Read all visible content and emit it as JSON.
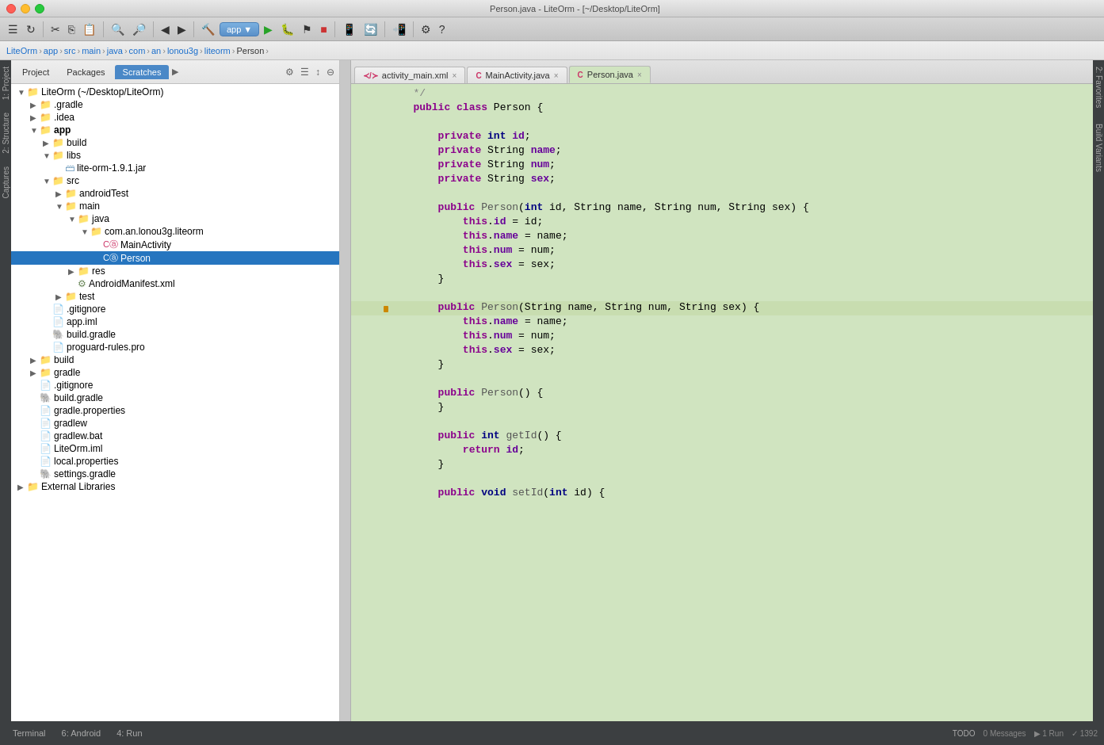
{
  "titleBar": {
    "title": "Person.java - LiteOrm - [~/Desktop/LiteOrm]"
  },
  "breadcrumb": {
    "items": [
      "LiteOrm",
      "app",
      "src",
      "main",
      "java",
      "com",
      "an",
      "lonou3g",
      "liteorm",
      "Person"
    ]
  },
  "projectPanel": {
    "tabs": [
      "Project",
      "Packages",
      "Scratches"
    ],
    "activeTab": "Project",
    "rootLabel": "LiteOrm (~/Desktop/LiteOrm)"
  },
  "editorTabs": [
    {
      "label": "activity_main.xml",
      "type": "xml",
      "active": false
    },
    {
      "label": "MainActivity.java",
      "type": "java",
      "active": false
    },
    {
      "label": "Person.java",
      "type": "java",
      "active": true
    }
  ],
  "codeLines": [
    {
      "num": "",
      "content": "   */"
    },
    {
      "num": "",
      "content": "   public class Person {"
    },
    {
      "num": "",
      "content": ""
    },
    {
      "num": "",
      "content": "       private int id;"
    },
    {
      "num": "",
      "content": "       private String name;"
    },
    {
      "num": "",
      "content": "       private String num;"
    },
    {
      "num": "",
      "content": "       private String sex;"
    },
    {
      "num": "",
      "content": ""
    },
    {
      "num": "",
      "content": "       public Person(int id, String name, String num, String sex) {"
    },
    {
      "num": "",
      "content": "           this.id = id;"
    },
    {
      "num": "",
      "content": "           this.name = name;"
    },
    {
      "num": "",
      "content": "           this.num = num;"
    },
    {
      "num": "",
      "content": "           this.sex = sex;"
    },
    {
      "num": "",
      "content": "       }"
    },
    {
      "num": "",
      "content": ""
    },
    {
      "num": "",
      "content": "       public Person(String name, String num, String sex) {",
      "highlighted": true
    },
    {
      "num": "",
      "content": "           this.name = name;"
    },
    {
      "num": "",
      "content": "           this.num = num;"
    },
    {
      "num": "",
      "content": "           this.sex = sex;"
    },
    {
      "num": "",
      "content": "       }"
    },
    {
      "num": "",
      "content": ""
    },
    {
      "num": "",
      "content": "       public Person() {"
    },
    {
      "num": "",
      "content": "       }"
    },
    {
      "num": "",
      "content": ""
    },
    {
      "num": "",
      "content": "       public int getId() {"
    },
    {
      "num": "",
      "content": "           return id;"
    },
    {
      "num": "",
      "content": "       }"
    },
    {
      "num": "",
      "content": ""
    },
    {
      "num": "",
      "content": "       public void setId(int id) {"
    }
  ],
  "bottomTabs": [
    "Terminal",
    "6: Android",
    "4: Run",
    "0: Messages",
    "TODO"
  ]
}
